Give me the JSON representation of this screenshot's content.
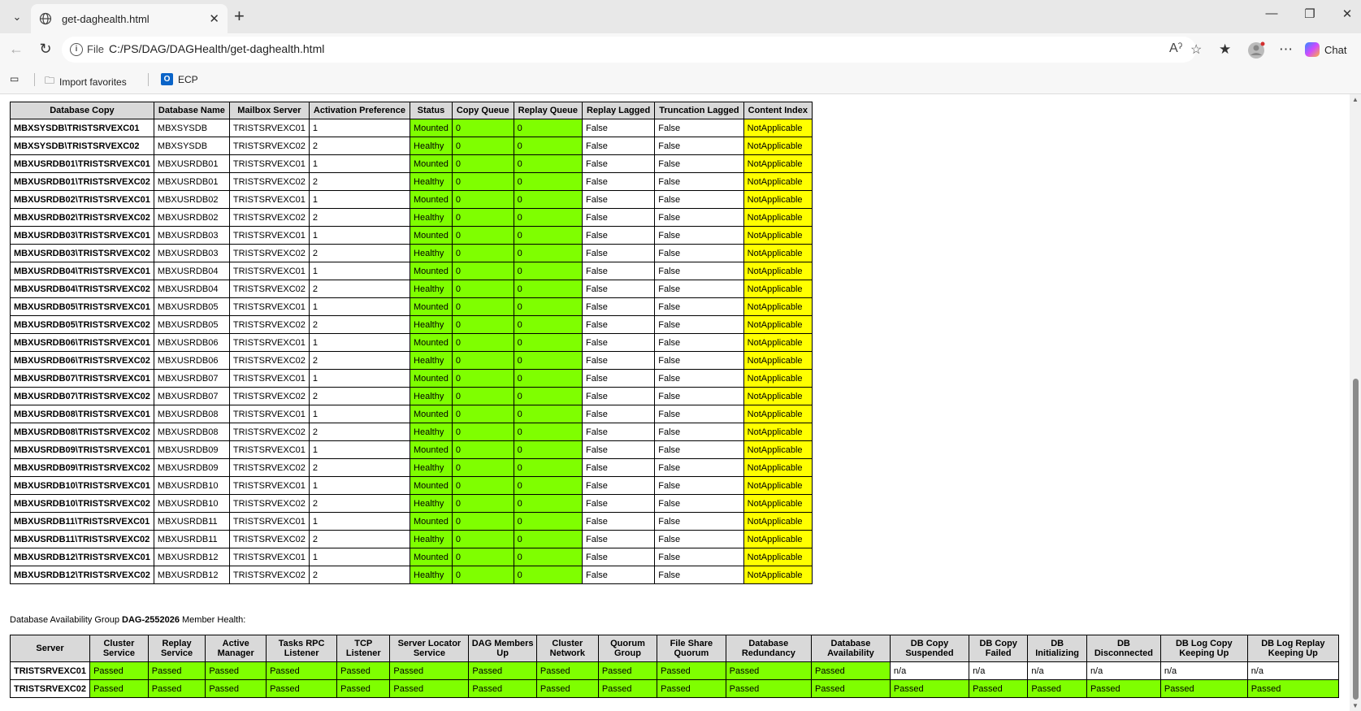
{
  "browser": {
    "tab_title": "get-daghealth.html",
    "address_scheme_label": "File",
    "address_url": "C:/PS/DAG/DAGHealth/get-daghealth.html",
    "chat_label": "Chat",
    "favorites": [
      {
        "label": "Import favorites"
      },
      {
        "label": "ECP"
      }
    ]
  },
  "copies": {
    "headers": [
      "Database Copy",
      "Database Name",
      "Mailbox Server",
      "Activation Preference",
      "Status",
      "Copy Queue",
      "Replay Queue",
      "Replay Lagged",
      "Truncation Lagged",
      "Content Index"
    ],
    "rows": [
      [
        "MBXSYSDB\\TRISTSRVEXC01",
        "MBXSYSDB",
        "TRISTSRVEXC01",
        "1",
        "Mounted",
        "0",
        "0",
        "False",
        "False",
        "NotApplicable"
      ],
      [
        "MBXSYSDB\\TRISTSRVEXC02",
        "MBXSYSDB",
        "TRISTSRVEXC02",
        "2",
        "Healthy",
        "0",
        "0",
        "False",
        "False",
        "NotApplicable"
      ],
      [
        "MBXUSRDB01\\TRISTSRVEXC01",
        "MBXUSRDB01",
        "TRISTSRVEXC01",
        "1",
        "Mounted",
        "0",
        "0",
        "False",
        "False",
        "NotApplicable"
      ],
      [
        "MBXUSRDB01\\TRISTSRVEXC02",
        "MBXUSRDB01",
        "TRISTSRVEXC02",
        "2",
        "Healthy",
        "0",
        "0",
        "False",
        "False",
        "NotApplicable"
      ],
      [
        "MBXUSRDB02\\TRISTSRVEXC01",
        "MBXUSRDB02",
        "TRISTSRVEXC01",
        "1",
        "Mounted",
        "0",
        "0",
        "False",
        "False",
        "NotApplicable"
      ],
      [
        "MBXUSRDB02\\TRISTSRVEXC02",
        "MBXUSRDB02",
        "TRISTSRVEXC02",
        "2",
        "Healthy",
        "0",
        "0",
        "False",
        "False",
        "NotApplicable"
      ],
      [
        "MBXUSRDB03\\TRISTSRVEXC01",
        "MBXUSRDB03",
        "TRISTSRVEXC01",
        "1",
        "Mounted",
        "0",
        "0",
        "False",
        "False",
        "NotApplicable"
      ],
      [
        "MBXUSRDB03\\TRISTSRVEXC02",
        "MBXUSRDB03",
        "TRISTSRVEXC02",
        "2",
        "Healthy",
        "0",
        "0",
        "False",
        "False",
        "NotApplicable"
      ],
      [
        "MBXUSRDB04\\TRISTSRVEXC01",
        "MBXUSRDB04",
        "TRISTSRVEXC01",
        "1",
        "Mounted",
        "0",
        "0",
        "False",
        "False",
        "NotApplicable"
      ],
      [
        "MBXUSRDB04\\TRISTSRVEXC02",
        "MBXUSRDB04",
        "TRISTSRVEXC02",
        "2",
        "Healthy",
        "0",
        "0",
        "False",
        "False",
        "NotApplicable"
      ],
      [
        "MBXUSRDB05\\TRISTSRVEXC01",
        "MBXUSRDB05",
        "TRISTSRVEXC01",
        "1",
        "Mounted",
        "0",
        "0",
        "False",
        "False",
        "NotApplicable"
      ],
      [
        "MBXUSRDB05\\TRISTSRVEXC02",
        "MBXUSRDB05",
        "TRISTSRVEXC02",
        "2",
        "Healthy",
        "0",
        "0",
        "False",
        "False",
        "NotApplicable"
      ],
      [
        "MBXUSRDB06\\TRISTSRVEXC01",
        "MBXUSRDB06",
        "TRISTSRVEXC01",
        "1",
        "Mounted",
        "0",
        "0",
        "False",
        "False",
        "NotApplicable"
      ],
      [
        "MBXUSRDB06\\TRISTSRVEXC02",
        "MBXUSRDB06",
        "TRISTSRVEXC02",
        "2",
        "Healthy",
        "0",
        "0",
        "False",
        "False",
        "NotApplicable"
      ],
      [
        "MBXUSRDB07\\TRISTSRVEXC01",
        "MBXUSRDB07",
        "TRISTSRVEXC01",
        "1",
        "Mounted",
        "0",
        "0",
        "False",
        "False",
        "NotApplicable"
      ],
      [
        "MBXUSRDB07\\TRISTSRVEXC02",
        "MBXUSRDB07",
        "TRISTSRVEXC02",
        "2",
        "Healthy",
        "0",
        "0",
        "False",
        "False",
        "NotApplicable"
      ],
      [
        "MBXUSRDB08\\TRISTSRVEXC01",
        "MBXUSRDB08",
        "TRISTSRVEXC01",
        "1",
        "Mounted",
        "0",
        "0",
        "False",
        "False",
        "NotApplicable"
      ],
      [
        "MBXUSRDB08\\TRISTSRVEXC02",
        "MBXUSRDB08",
        "TRISTSRVEXC02",
        "2",
        "Healthy",
        "0",
        "0",
        "False",
        "False",
        "NotApplicable"
      ],
      [
        "MBXUSRDB09\\TRISTSRVEXC01",
        "MBXUSRDB09",
        "TRISTSRVEXC01",
        "1",
        "Mounted",
        "0",
        "0",
        "False",
        "False",
        "NotApplicable"
      ],
      [
        "MBXUSRDB09\\TRISTSRVEXC02",
        "MBXUSRDB09",
        "TRISTSRVEXC02",
        "2",
        "Healthy",
        "0",
        "0",
        "False",
        "False",
        "NotApplicable"
      ],
      [
        "MBXUSRDB10\\TRISTSRVEXC01",
        "MBXUSRDB10",
        "TRISTSRVEXC01",
        "1",
        "Mounted",
        "0",
        "0",
        "False",
        "False",
        "NotApplicable"
      ],
      [
        "MBXUSRDB10\\TRISTSRVEXC02",
        "MBXUSRDB10",
        "TRISTSRVEXC02",
        "2",
        "Healthy",
        "0",
        "0",
        "False",
        "False",
        "NotApplicable"
      ],
      [
        "MBXUSRDB11\\TRISTSRVEXC01",
        "MBXUSRDB11",
        "TRISTSRVEXC01",
        "1",
        "Mounted",
        "0",
        "0",
        "False",
        "False",
        "NotApplicable"
      ],
      [
        "MBXUSRDB11\\TRISTSRVEXC02",
        "MBXUSRDB11",
        "TRISTSRVEXC02",
        "2",
        "Healthy",
        "0",
        "0",
        "False",
        "False",
        "NotApplicable"
      ],
      [
        "MBXUSRDB12\\TRISTSRVEXC01",
        "MBXUSRDB12",
        "TRISTSRVEXC01",
        "1",
        "Mounted",
        "0",
        "0",
        "False",
        "False",
        "NotApplicable"
      ],
      [
        "MBXUSRDB12\\TRISTSRVEXC02",
        "MBXUSRDB12",
        "TRISTSRVEXC02",
        "2",
        "Healthy",
        "0",
        "0",
        "False",
        "False",
        "NotApplicable"
      ]
    ]
  },
  "member_health": {
    "label_prefix": "Database Availability Group ",
    "dag_name": "DAG-2552026",
    "label_suffix": " Member Health:",
    "headers": [
      "Server",
      "Cluster Service",
      "Replay Service",
      "Active Manager",
      "Tasks RPC Listener",
      "TCP Listener",
      "Server Locator Service",
      "DAG Members Up",
      "Cluster Network",
      "Quorum Group",
      "File Share Quorum",
      "Database Redundancy",
      "Database Availability",
      "DB Copy Suspended",
      "DB Copy Failed",
      "DB Initializing",
      "DB Disconnected",
      "DB Log Copy Keeping Up",
      "DB Log Replay Keeping Up"
    ],
    "rows": [
      [
        "TRISTSRVEXC01",
        "Passed",
        "Passed",
        "Passed",
        "Passed",
        "Passed",
        "Passed",
        "Passed",
        "Passed",
        "Passed",
        "Passed",
        "Passed",
        "Passed",
        "n/a",
        "n/a",
        "n/a",
        "n/a",
        "n/a",
        "n/a"
      ],
      [
        "TRISTSRVEXC02",
        "Passed",
        "Passed",
        "Passed",
        "Passed",
        "Passed",
        "Passed",
        "Passed",
        "Passed",
        "Passed",
        "Passed",
        "Passed",
        "Passed",
        "Passed",
        "Passed",
        "Passed",
        "Passed",
        "Passed",
        "Passed"
      ]
    ]
  },
  "colors": {
    "pass": "#7fff00",
    "warn": "#ffff00",
    "header": "#d9d9d9"
  },
  "icons": [
    "tab-menu-icon",
    "globe-icon",
    "close-icon",
    "new-tab-icon",
    "minimize-icon",
    "maximize-icon",
    "window-close-icon",
    "back-icon",
    "refresh-icon",
    "info-icon",
    "read-aloud-icon",
    "favorite-star-icon",
    "favorites-icon",
    "profile-icon",
    "more-icon",
    "copilot-icon",
    "reading-list-icon",
    "import-folder-icon",
    "outlook-icon"
  ]
}
